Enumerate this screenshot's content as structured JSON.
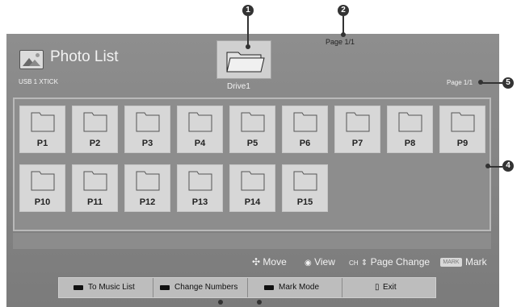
{
  "header": {
    "title": "Photo List",
    "usb_label": "USB 1 XTICK",
    "drive_label": "Drive1",
    "page_top": "Page 1/1",
    "page_right": "Page 1/1"
  },
  "folders": [
    "P1",
    "P2",
    "P3",
    "P4",
    "P5",
    "P6",
    "P7",
    "P8",
    "P9",
    "P10",
    "P11",
    "P12",
    "P13",
    "P14",
    "P15"
  ],
  "help": {
    "move": "Move",
    "view": "View",
    "ch_badge": "CH",
    "page_change": "Page Change",
    "mark_badge": "MARK",
    "mark": "Mark"
  },
  "buttons": {
    "music": "To Music List",
    "numbers": "Change Numbers",
    "mark_mode": "Mark Mode",
    "exit": "Exit"
  },
  "callouts": [
    "1",
    "2",
    "4",
    "5"
  ]
}
